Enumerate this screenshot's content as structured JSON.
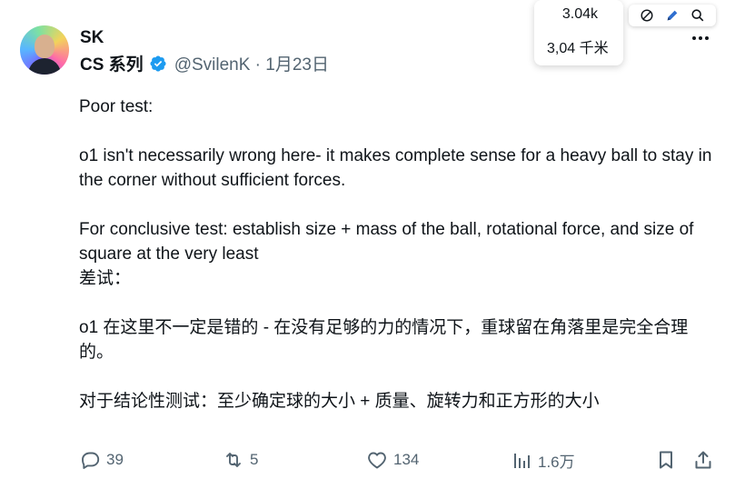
{
  "author": {
    "name": "SK",
    "subname": "CS 系列",
    "handle": "@SvilenK · 1月23日"
  },
  "popup": {
    "value1": "3.04k",
    "value2": "3,04 千米"
  },
  "toolbar": {
    "icons": [
      "slash-circle-icon",
      "pencil-icon",
      "search-icon"
    ]
  },
  "post": {
    "line1": "Poor test:",
    "line2": "o1 isn't necessarily wrong here- it makes complete sense for a heavy ball to stay in the corner without sufficient forces.",
    "line3": "For conclusive test: establish size + mass of the ball, rotational force, and size of square at the very least",
    "cn_line1": "差试：",
    "cn_line2": "o1 在这里不一定是错的 - 在没有足够的力的情况下，重球留在角落里是完全合理的。",
    "cn_line3": "对于结论性测试：至少确定球的大小 + 质量、旋转力和正方形的大小"
  },
  "actions": {
    "replies": "39",
    "reposts": "5",
    "likes": "134",
    "views": "1.6万"
  },
  "colors": {
    "verified": "#1d9bf0",
    "text": "#0f1419",
    "muted": "#536471"
  }
}
